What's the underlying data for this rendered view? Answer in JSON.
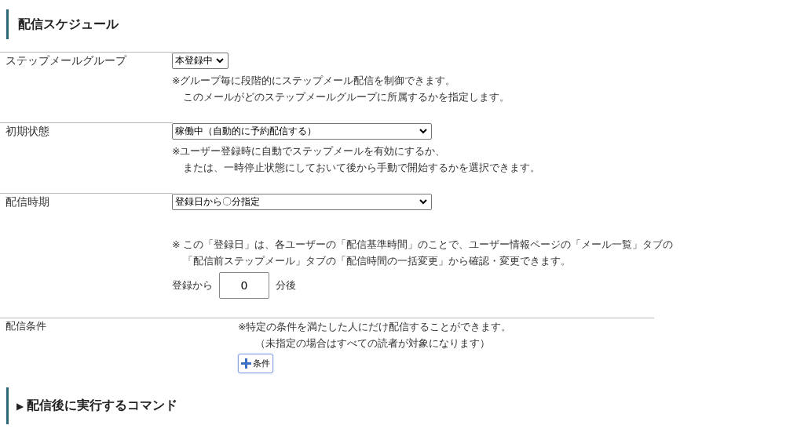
{
  "title": "配信スケジュール",
  "rows": [
    {
      "kind": "select",
      "label": "ステップメールグループ",
      "select": {
        "value": "本登録中",
        "wide": false
      },
      "notes": [
        "※グループ毎に段階的にステップメール配信を制御できます。",
        "このメールがどのステップメールグループに所属するかを指定します。"
      ]
    },
    {
      "kind": "select",
      "label": "初期状態",
      "select": {
        "value": "稼働中（自動的に予約配信する）",
        "wide": true
      },
      "notes": [
        "※ユーザー登録時に自動でステップメールを有効にするか、",
        "または、一時停止状態にしておいて後から手動で開始するかを選択できます。"
      ]
    },
    {
      "kind": "timing",
      "label": "配信時期",
      "select": {
        "value": "登録日から〇分指定",
        "wide": true
      },
      "notes": [
        "※ この「登録日」は、各ユーザーの「配信基準時間」のことで、ユーザー情報ページの「メール一覧」タブの",
        "「配信前ステップメール」タブの「配信時間の一括変更」から確認・変更できます。"
      ],
      "offset": {
        "before": "登録から",
        "value": "0",
        "after": "分後"
      }
    },
    {
      "kind": "condition",
      "label": "配信条件",
      "notes": [
        "※特定の条件を満たした人にだけ配信することができます。",
        "（未指定の場合はすべての読者が対象になります）"
      ],
      "button": "条件"
    }
  ],
  "sections": [
    {
      "marker": "▶",
      "title": "配信後に実行するコマンド"
    }
  ]
}
